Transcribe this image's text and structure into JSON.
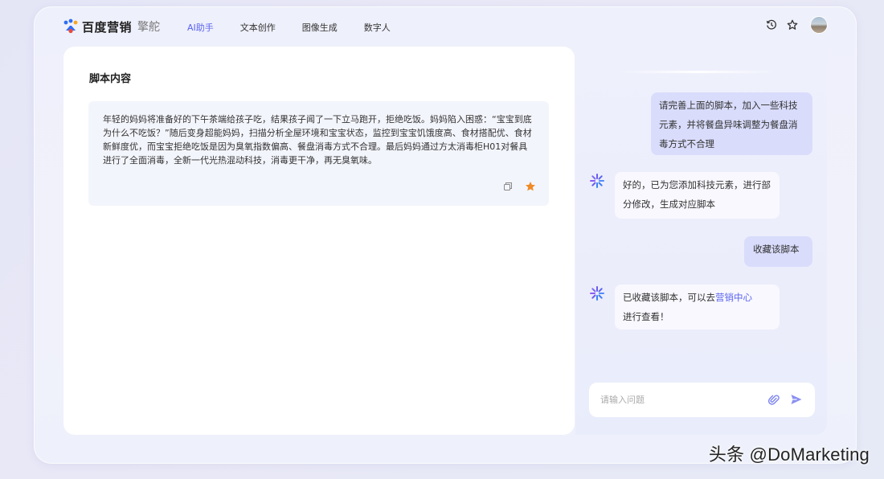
{
  "header": {
    "brand": "百度营销",
    "product": "擎舵",
    "nav": [
      {
        "label": "AI助手",
        "active": true
      },
      {
        "label": "文本创作",
        "active": false
      },
      {
        "label": "图像生成",
        "active": false
      },
      {
        "label": "数字人",
        "active": false
      }
    ],
    "icons": [
      "history-icon",
      "star-outline-icon",
      "avatar"
    ]
  },
  "script_panel": {
    "title": "脚本内容",
    "content": "年轻的妈妈将准备好的下午茶端给孩子吃，结果孩子闻了一下立马跑开，拒绝吃饭。妈妈陷入困惑：“宝宝到底为什么不吃饭？”随后变身超能妈妈，扫描分析全屋环境和宝宝状态，监控到宝宝饥饿度高、食材搭配优、食材新鲜度优，而宝宝拒绝吃饭是因为臭氧指数偏高、餐盘消毒方式不合理。最后妈妈通过方太消毒柜H01对餐具进行了全面消毒，全新一代光热混动科技，消毒更干净，再无臭氧味。",
    "actions": [
      "copy-icon",
      "favorite-star-icon"
    ]
  },
  "chat": {
    "messages": [
      {
        "role": "user",
        "text": "请完善上面的脚本，加入一些科技元素，并将餐盘异味调整为餐盘消毒方式不合理"
      },
      {
        "role": "bot",
        "text": "好的，已为您添加科技元素，进行部分修改，生成对应脚本"
      },
      {
        "role": "user",
        "text": "收藏该脚本"
      },
      {
        "role": "bot",
        "text_before": "已收藏该脚本，可以去",
        "link": "营销中心",
        "text_after": "进行查看！"
      }
    ],
    "input_placeholder": "请输入问题"
  },
  "colors": {
    "accent": "#5b64f0",
    "user_bubble": "#d9dcfb",
    "favorite": "#f08a24"
  },
  "watermark": "头条 @DoMarketing"
}
